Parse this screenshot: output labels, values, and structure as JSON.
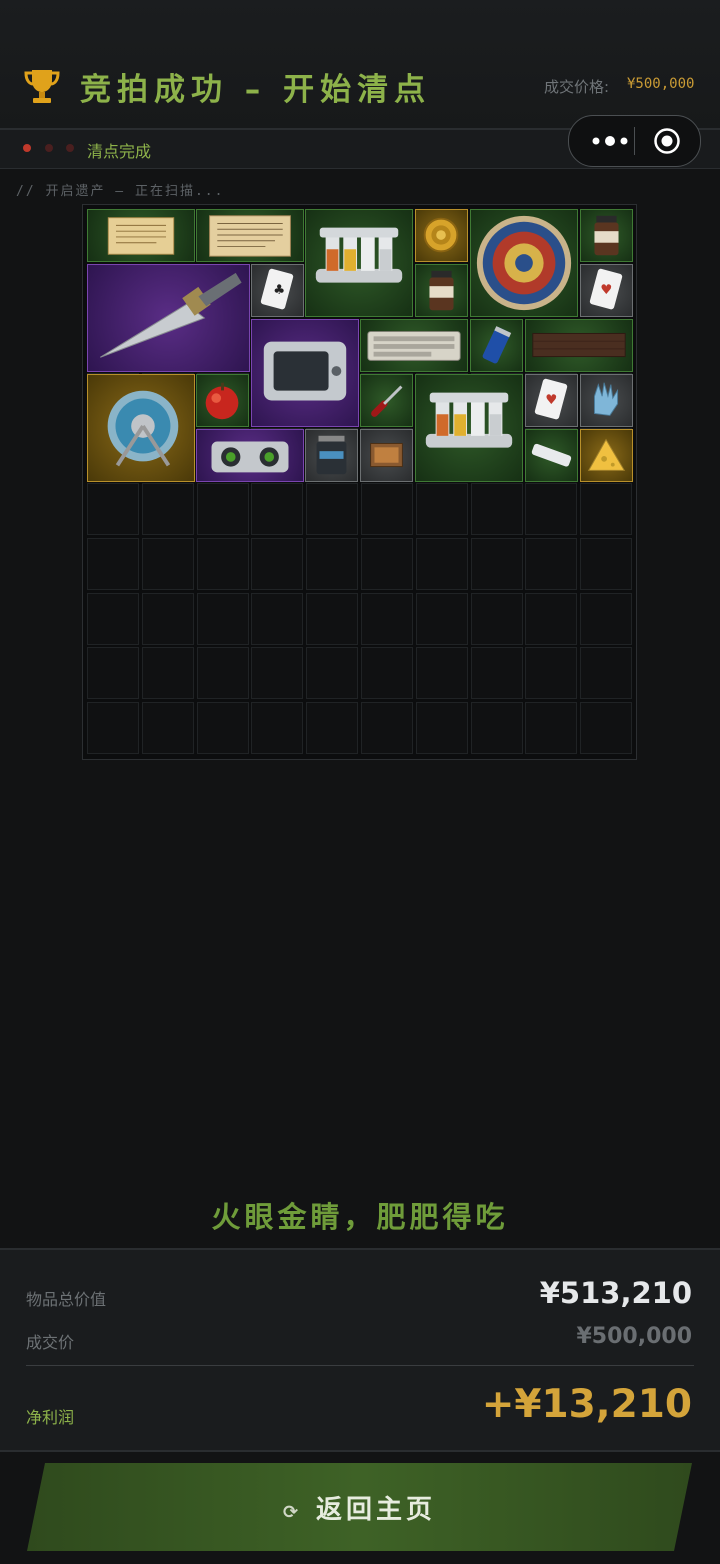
{
  "header": {
    "title": "竞拍成功 – 开始清点",
    "price_label": "成交价格:",
    "price_value": "¥500,000"
  },
  "status": {
    "text": "清点完成",
    "dot_colors": [
      "#c0392b",
      "#5a2020",
      "#5a2020"
    ]
  },
  "scan_text": "// 开启遗产 – 正在扫描...",
  "miniapp_capsule": {
    "more_icon": "more-dots-icon",
    "close_icon": "target-circle-icon"
  },
  "colors": {
    "accent": "#8db24a",
    "gold": "#c99b35",
    "rarity_green": "#2f5a28",
    "rarity_purple": "#5a2d86",
    "rarity_gold": "#8a6a18",
    "rarity_grey": "#4a4d4f"
  },
  "inventory": {
    "columns": 10,
    "rows": 10,
    "items": [
      {
        "name": "parchment-document",
        "rarity": "green"
      },
      {
        "name": "old-parchment-letter",
        "rarity": "green"
      },
      {
        "name": "spice-rack",
        "rarity": "green"
      },
      {
        "name": "gold-coin",
        "rarity": "gold"
      },
      {
        "name": "decorative-plate",
        "rarity": "green"
      },
      {
        "name": "instant-coffee-jar",
        "rarity": "green"
      },
      {
        "name": "hunting-knife",
        "rarity": "purple"
      },
      {
        "name": "playing-card",
        "rarity": "grey"
      },
      {
        "name": "coffee-jar",
        "rarity": "green"
      },
      {
        "name": "playing-card",
        "rarity": "grey"
      },
      {
        "name": "incubator-machine",
        "rarity": "purple"
      },
      {
        "name": "keyboard",
        "rarity": "green"
      },
      {
        "name": "energy-drink-can",
        "rarity": "green"
      },
      {
        "name": "wooden-plank",
        "rarity": "green"
      },
      {
        "name": "cable-reel",
        "rarity": "gold"
      },
      {
        "name": "apple",
        "rarity": "green"
      },
      {
        "name": "screwdriver",
        "rarity": "green"
      },
      {
        "name": "spice-rack",
        "rarity": "green"
      },
      {
        "name": "playing-card",
        "rarity": "grey"
      },
      {
        "name": "latex-glove",
        "rarity": "grey"
      },
      {
        "name": "boombox",
        "rarity": "purple"
      },
      {
        "name": "protein-tub",
        "rarity": "grey"
      },
      {
        "name": "matchbox",
        "rarity": "grey"
      },
      {
        "name": "power-strip",
        "rarity": "green"
      },
      {
        "name": "cheese-wedge",
        "rarity": "gold"
      }
    ]
  },
  "slogan": "火眼金睛，肥肥得吃",
  "summary": {
    "total_label": "物品总价值",
    "total_value": "¥513,210",
    "deal_label": "成交价",
    "deal_value": "¥500,000",
    "profit_label": "净利润",
    "profit_value": "+¥13,210"
  },
  "home_button": {
    "icon": "refresh-icon",
    "icon_glyph": "⟳",
    "label": "返回主页"
  }
}
